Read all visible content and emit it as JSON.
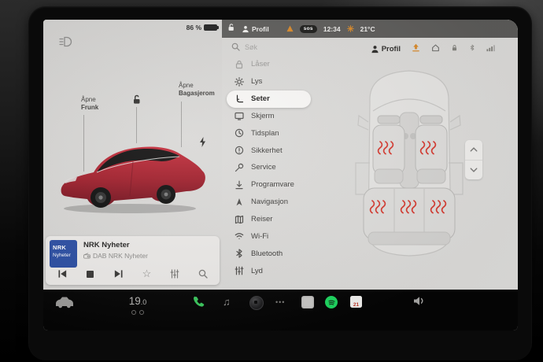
{
  "status_indicators": {
    "battery_percent": "86 %",
    "headlight_icon": "headlights-on"
  },
  "status_bar": {
    "lock_icon": "unlocked",
    "profile_label": "Profil",
    "warning_icon": "warning",
    "sos_badge": "sos",
    "time": "12:34",
    "climate_icon": "climate-alert",
    "outside_temp": "21°C"
  },
  "settings": {
    "search_placeholder": "Søk",
    "profile_label": "Profil",
    "menu": [
      {
        "label": "Låser",
        "state": "dimmed"
      },
      {
        "label": "Lys",
        "state": "normal"
      },
      {
        "label": "Seter",
        "state": "selected"
      },
      {
        "label": "Skjerm",
        "state": "normal"
      },
      {
        "label": "Tidsplan",
        "state": "normal"
      },
      {
        "label": "Sikkerhet",
        "state": "normal"
      },
      {
        "label": "Service",
        "state": "normal"
      },
      {
        "label": "Programvare",
        "state": "normal"
      },
      {
        "label": "Navigasjon",
        "state": "normal"
      },
      {
        "label": "Reiser",
        "state": "normal"
      },
      {
        "label": "Wi-Fi",
        "state": "normal"
      },
      {
        "label": "Bluetooth",
        "state": "normal"
      },
      {
        "label": "Lyd",
        "state": "normal"
      }
    ],
    "seat_heating": {
      "front_left": "on",
      "front_right": "on",
      "rear_left": "on",
      "rear_center": "on",
      "rear_right": "on"
    }
  },
  "vehicle": {
    "frunk_label_line1": "Åpne",
    "frunk_label_line2": "Frunk",
    "trunk_label_line1": "Åpne",
    "trunk_label_line2": "Bagasjerom",
    "lock_icon": "unlocked",
    "charge_icon": "lightning-bolt",
    "body_color": "#a91f2c"
  },
  "media": {
    "title": "NRK Nyheter",
    "subtitle": "DAB NRK Nyheter",
    "art_line1": "NRK",
    "art_line2": "Nyheter",
    "star_glyph": "☆"
  },
  "launcher": {
    "temperature": "19",
    "temperature_decimal": ".0",
    "calendar_day": "21",
    "music_note_glyph": "♫",
    "ellipsis_glyph": "•••"
  },
  "colors": {
    "heat_red": "#d6382e",
    "spotify_green": "#1ed760",
    "phone_green": "#3bc75d",
    "nrk_blue": "#2b4ea3",
    "calendar_red": "#d93a31",
    "accent_orange": "#d98a2b",
    "status_bar_gray": "#5d5c5a"
  }
}
